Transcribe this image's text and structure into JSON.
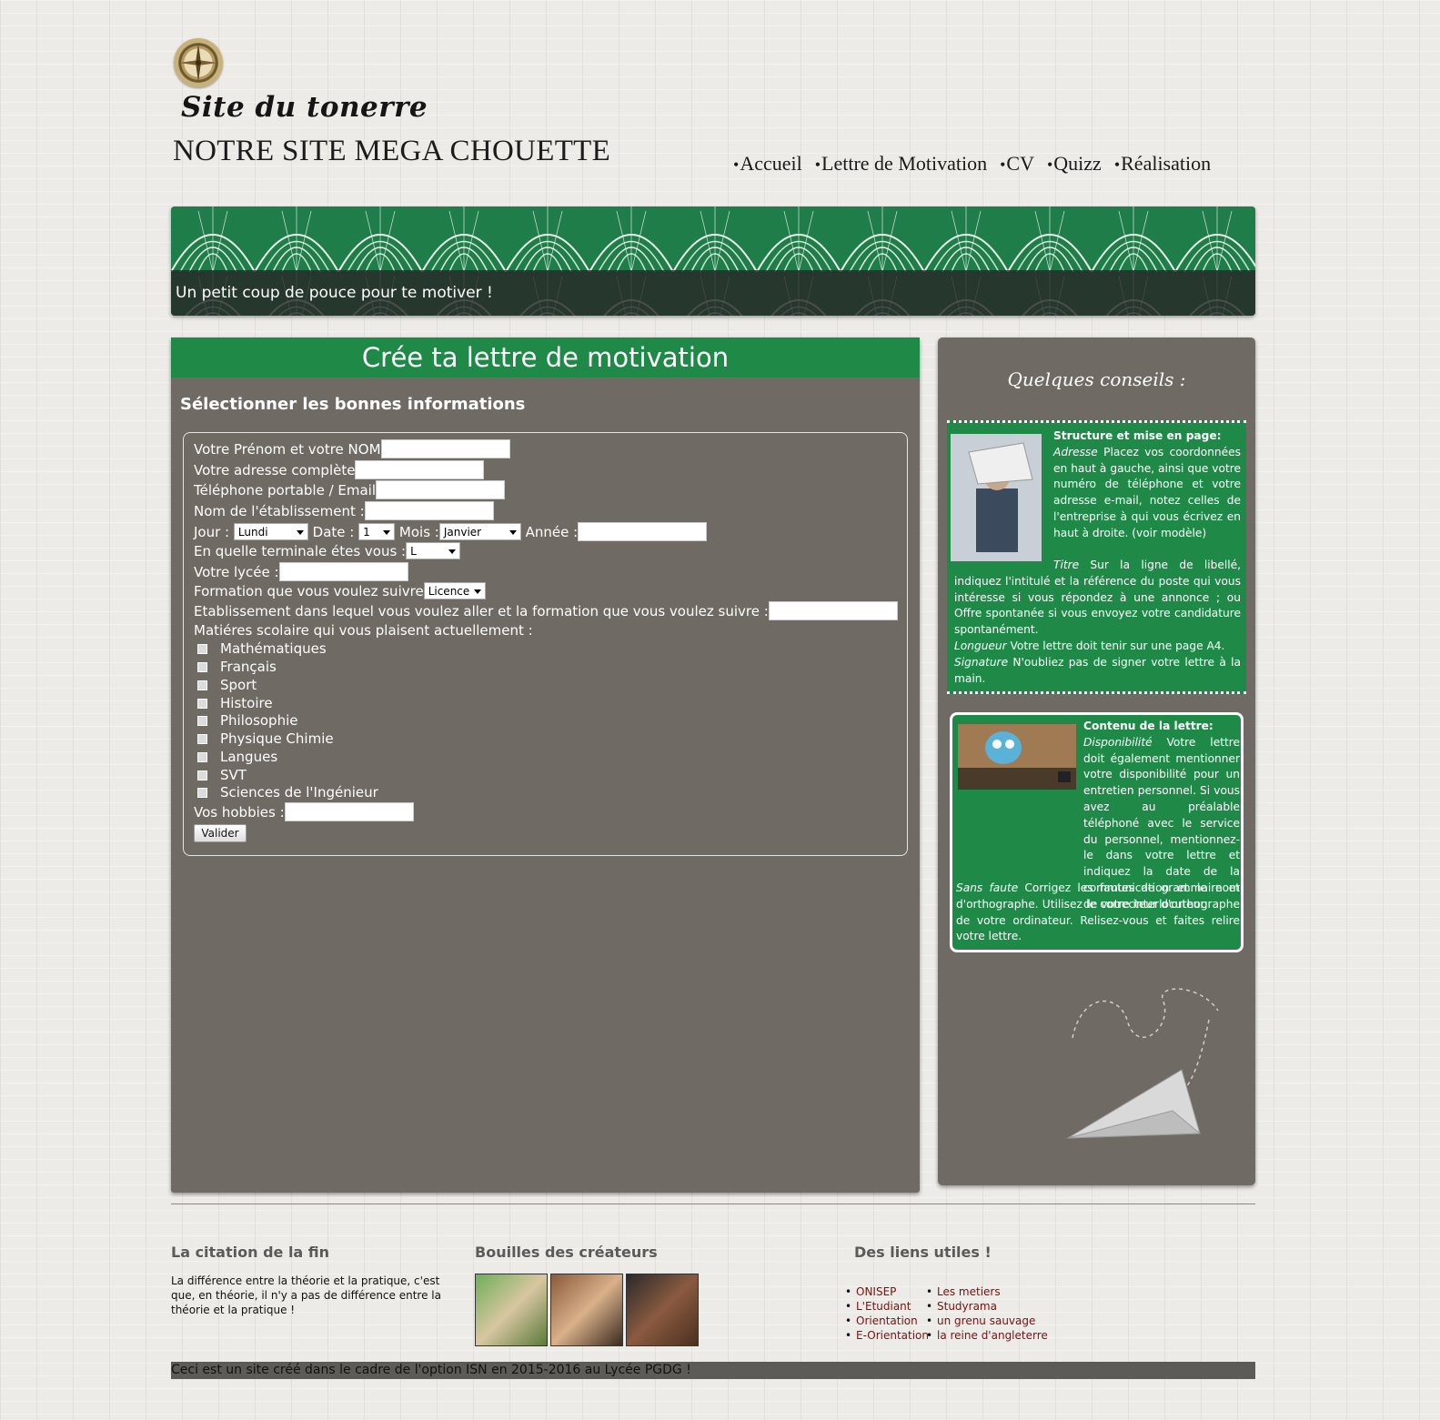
{
  "header": {
    "logo_text": "Site du tonerre",
    "site_title": "NOTRE SITE MEGA CHOUETTE",
    "nav": [
      "Accueil",
      "Lettre de Motivation",
      "CV",
      "Quizz",
      "Réalisation"
    ],
    "nav_bullet": "•"
  },
  "banner": {
    "caption": "Un petit coup de pouce pour te motiver !",
    "colors": {
      "green": "#1f7d4a",
      "overlay": "#282828"
    }
  },
  "main": {
    "title": "Crée ta lettre de motivation",
    "subtitle": "Sélectionner les bonnes informations",
    "form": {
      "name_label": "Votre Prénom et votre NOM",
      "address_label": "Votre adresse complète",
      "phone_label": "Téléphone portable / Email",
      "company_label": "Nom de l'établissement :",
      "day_label": "Jour :",
      "day_value": "Lundi",
      "date_label": "Date :",
      "date_value": "1",
      "month_label": "Mois :",
      "month_value": "Janvier",
      "year_label": "Année :",
      "terminale_label": "En quelle terminale étes vous :",
      "terminale_value": "L",
      "lycee_label": "Votre lycée :",
      "formation_label": "Formation que vous voulez suivre",
      "formation_value": "Licence",
      "etab_label": "Etablissement dans lequel vous voulez aller et la formation que vous voulez suivre :",
      "subjects_label": "Matiéres scolaire qui vous plaisent actuellement :",
      "subjects": [
        "Mathématiques",
        "Français",
        "Sport",
        "Histoire",
        "Philosophie",
        "Physique Chimie",
        "Langues",
        "SVT",
        "Sciences de l'Ingénieur"
      ],
      "hobbies_label": "Vos hobbies :",
      "submit": "Valider"
    }
  },
  "sidebar": {
    "title": "Quelques conseils :",
    "tip1": {
      "heading": "Structure et mise en page:",
      "adresse_term": "Adresse",
      "adresse_text": "Placez vos coordonnées en haut à gauche, ainsi que votre numéro de téléphone et votre adresse e-mail, notez celles de l'entreprise à qui vous écrivez en haut à droite. (voir modèle)",
      "titre_term": "Titre",
      "titre_text": "Sur la ligne de libellé, indiquez l'intitulé et la référence du poste qui vous intéresse si vous répondez à une annonce ; ou Offre spontanée si vous envoyez votre candidature spontanément.",
      "longueur_term": "Longueur",
      "longueur_text": "Votre lettre doit tenir sur une page A4.",
      "signature_term": "Signature",
      "signature_text": "N'oubliez pas de signer votre lettre à la main."
    },
    "tip2": {
      "heading": "Contenu de la lettre:",
      "dispo_term": "Disponibilité",
      "dispo_text": "Votre lettre doit également mentionner votre disponibilité pour un entretien personnel. Si vous avez au préalable téléphoné avec le service du personnel, mentionnez-le dans votre lettre et indiquez la date de la communication et le nom de votre interlocuteur.",
      "faute_term": "Sans faute",
      "faute_text": "Corrigez les fautes de grammaire et d'orthographe. Utilisez le correcteur d'orthographe de votre ordinateur. Relisez-vous et faites relire votre lettre."
    }
  },
  "footer": {
    "quote_title": "La citation de la fin",
    "quote_text": "La différence entre la théorie et la pratique, c'est que, en théorie, il n'y a pas de différence entre la théorie et la pratique !",
    "faces_title": "Bouilles des créateurs",
    "links_title": "Des liens utiles !",
    "links_col1": [
      "ONISEP",
      "L'Etudiant",
      "Orientation",
      "E-Orientation"
    ],
    "links_col2": [
      "Les metiers",
      "Studyrama",
      "un grenu sauvage",
      "la reine d'angleterre"
    ],
    "bottom_text": "Ceci est un site créé dans le cadre de l'option ISN en 2015-2016 au Lycée PGDG !"
  }
}
